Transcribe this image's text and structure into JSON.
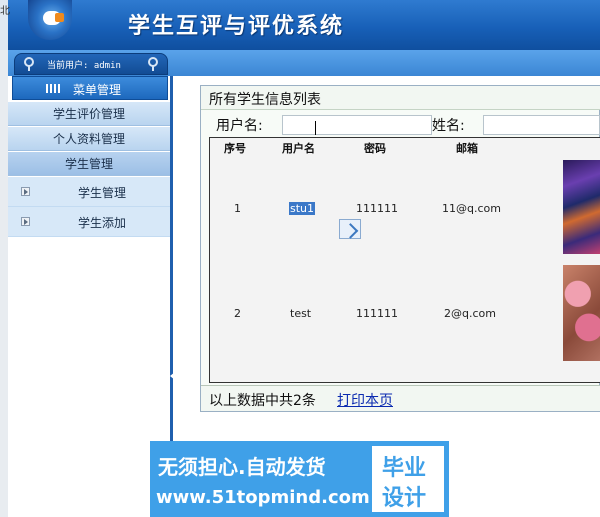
{
  "window": {
    "edge_char": "北",
    "app_title": "学生互评与评优系统"
  },
  "sidebar": {
    "current_user": "当前用户: admin",
    "menu_title": "菜单管理",
    "items": [
      {
        "label": "学生评价管理"
      },
      {
        "label": "个人资料管理"
      },
      {
        "label": "学生管理"
      }
    ],
    "subitems": [
      {
        "label": "学生管理"
      },
      {
        "label": "学生添加"
      }
    ]
  },
  "main": {
    "title": "所有学生信息列表",
    "search": {
      "username_label": "用户名:",
      "username_value": "",
      "name_label": "姓名:",
      "name_value": ""
    },
    "table": {
      "headers": [
        "序号",
        "用户名",
        "密码",
        "邮箱"
      ],
      "rows": [
        {
          "index": "1",
          "username": "stu1",
          "password": "111111",
          "email": "11@q.com"
        },
        {
          "index": "2",
          "username": "test",
          "password": "111111",
          "email": "2@q.com"
        }
      ]
    },
    "footer": {
      "summary": "以上数据中共2条",
      "print_label": "打印本页"
    }
  },
  "watermark": {
    "slogan": "无须担心.自动发货",
    "url": "www.51topmind.com",
    "badge_line1": "毕业",
    "badge_line2": "设计"
  },
  "colors": {
    "banner": "#1860b8",
    "nav": "#c8ddf3",
    "selection": "#3b78c8",
    "link": "#0a2ab0",
    "watermark": "#3fa0e8"
  }
}
